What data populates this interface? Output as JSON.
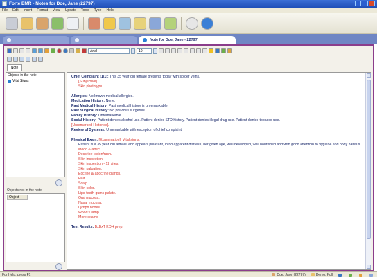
{
  "window": {
    "title": "Forte EMR - Notes for Doe, Jane (22797)"
  },
  "menu": [
    "File",
    "Edit",
    "Insert",
    "Format",
    "View",
    "Update",
    "Tools",
    "Type",
    "Help"
  ],
  "tabs": [
    {
      "label": ""
    },
    {
      "label": ""
    },
    {
      "label": "Note for Doe, Jane - 22797"
    }
  ],
  "format": {
    "font": "Arial",
    "size": "10"
  },
  "subtab": "Note",
  "left": {
    "objects_in_note_label": "Objects in the note",
    "items": [
      "Vital Signs"
    ],
    "objects_not_in_note_label": "Objects not in the note",
    "column": "Object"
  },
  "note": {
    "chief_complaint_label": "Chief Complaint (1/1):",
    "chief_complaint_text": "This 35 year old female presents today with spider veins.",
    "subjective": "[Subjective].",
    "skin_phototype": "Skin phototype.",
    "allergies_label": "Allergies:",
    "allergies_text": "No known medical allergies.",
    "medication_label": "Medication History:",
    "medication_text": "None.",
    "pmh_label": "Past Medical History:",
    "pmh_text": "Past medical history is unremarkable.",
    "psh_label": "Past Surgical History:",
    "psh_text": "No previous surgeries.",
    "family_label": "Family History:",
    "family_text": "Unremarkable.",
    "social_label": "Social History:",
    "social_text": "Patient denies alcohol use. Patient denies STD history. Patient denies illegal drug use. Patient denies tobacco use.",
    "unremarked": "[Unremarked Histories].",
    "ros_label": "Review of Systems:",
    "ros_text": "Unremarkable with exception of chief complaint.",
    "pe_label": "Physical Exam:",
    "pe_exam": "[Examination].",
    "pe_vital": "Vital signs.",
    "pe_text": "Patient is a 35 year old female who appears pleasant, in no apparent distress, her given age, well developed, well nourished and with good attention to hygiene and body habitus.",
    "exam_items": [
      "Mood & affect.",
      "Describe lesion/rash.",
      "Skin inspection.",
      "Skin inspection - 12 sites.",
      "Skin palpation.",
      "Eccrine & apocrine glands.",
      "Hair.",
      "Scalp.",
      "Skin color.",
      "Lips-teeth-gums-palate.",
      "Oral mucosa.",
      "Nasal mucosa.",
      "Lymph nodes.",
      "Wood's lamp.",
      "More exams"
    ],
    "test_label": "Test Results:",
    "test_text": "BxBxT KOH prep."
  },
  "status": {
    "help": "For Help, press F1",
    "patient": "Doe, Jane (22797)",
    "user": "Demo, Full"
  }
}
